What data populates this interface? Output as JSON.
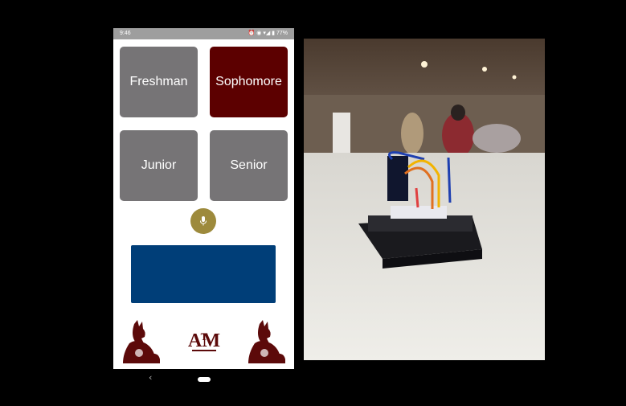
{
  "status_bar": {
    "time": "9:46",
    "indicators": "⏰ ◉ ▾◢ ▮ 77%"
  },
  "grade_buttons": [
    {
      "label": "Freshman",
      "color": "#767476",
      "selected": false
    },
    {
      "label": "Sophomore",
      "color": "#5c0000",
      "selected": true
    },
    {
      "label": "Junior",
      "color": "#767476",
      "selected": false
    },
    {
      "label": "Senior",
      "color": "#767476",
      "selected": false
    }
  ],
  "mic_button": {
    "icon": "microphone-icon",
    "color": "#9d8a3c"
  },
  "output_box": {
    "text": "",
    "color": "#003e78"
  },
  "branding": {
    "left_icon": "reveille-dog-icon",
    "center_logo": "ATM",
    "right_icon": "reveille-dog-icon",
    "color": "#5c0a0a"
  },
  "nav_bar": {
    "back_icon": "back-icon",
    "home_icon": "home-pill-icon"
  },
  "photo": {
    "subject": "arduino-breadboard-photo"
  }
}
